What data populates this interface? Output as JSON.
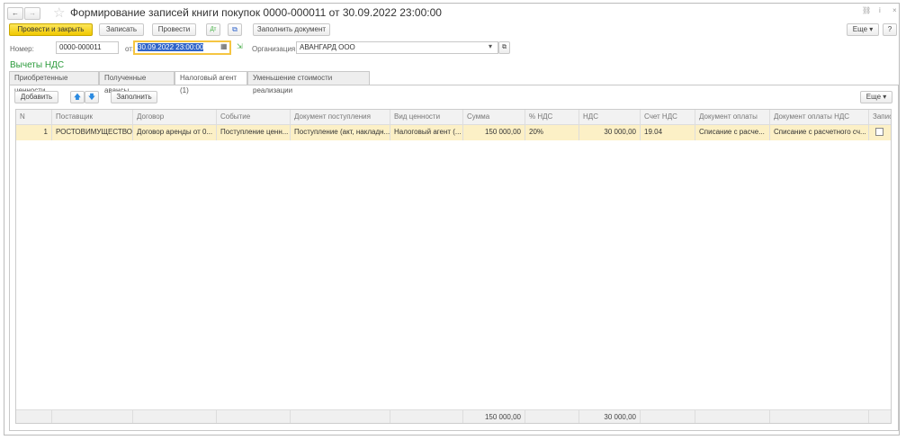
{
  "window": {
    "title": "Формирование записей книги покупок 0000-000011 от 30.09.2022 23:00:00"
  },
  "toolbar": {
    "post_close": "Провести и закрыть",
    "save": "Записать",
    "post": "Провести",
    "fill_doc": "Заполнить документ",
    "more": "Еще",
    "help": "?"
  },
  "form": {
    "number_label": "Номер:",
    "number": "0000-000011",
    "date_label": "от:",
    "date": "30.09.2022 23:00:00",
    "org_label": "Организация:",
    "org": "АВАНГАРД ООО",
    "section": "Вычеты НДС"
  },
  "tabs": [
    "Приобретенные ценности",
    "Полученные авансы",
    "Налоговый агент (1)",
    "Уменьшение стоимости реализации"
  ],
  "table_toolbar": {
    "add": "Добавить",
    "fill": "Заполнить",
    "more": "Еще"
  },
  "table": {
    "columns": [
      "N",
      "Поставщик",
      "Договор",
      "Событие",
      "Документ поступления",
      "Вид ценности",
      "Сумма",
      "% НДС",
      "НДС",
      "Счет НДС",
      "Документ оплаты",
      "Документ оплаты НДС",
      "Запис"
    ],
    "rows": [
      [
        "1",
        "РОСТОВИМУЩЕСТВО",
        "Договор аренды от 0...",
        "Поступление ценн...",
        "Поступление (акт, накладн...",
        "Налоговый агент (...",
        "150 000,00",
        "20%",
        "30 000,00",
        "19.04",
        "Списание с расче...",
        "Списание с расчетного сч...",
        ""
      ]
    ],
    "totals": {
      "sum": "150 000,00",
      "vat": "30 000,00"
    }
  },
  "scrollbar": {
    "position_fraction": 0.0,
    "visible_fraction": 0.78
  }
}
